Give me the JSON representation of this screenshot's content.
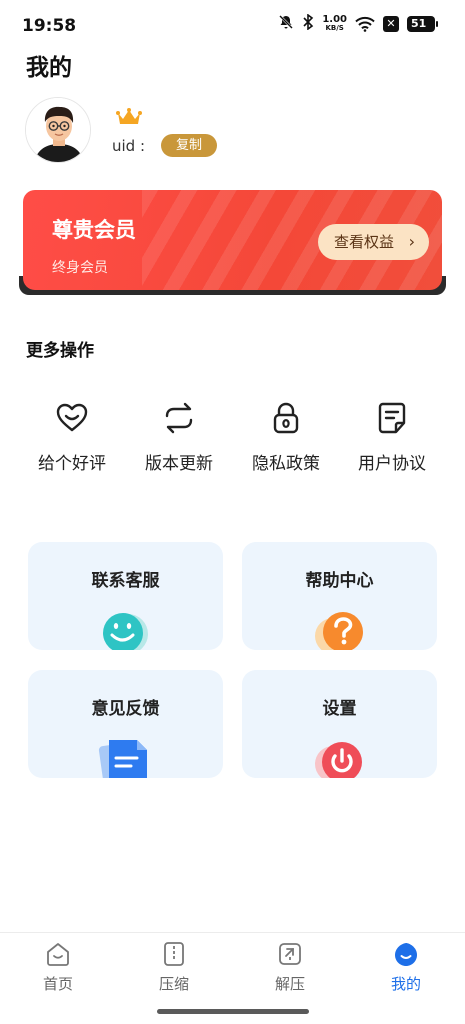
{
  "status_bar": {
    "time": "19:58",
    "net_speed_value": "1.00",
    "net_speed_unit": "KB/S",
    "battery": "51"
  },
  "page": {
    "title": "我的"
  },
  "profile": {
    "uid_label": "uid :",
    "copy_label": "复制"
  },
  "vip": {
    "title": "尊贵会员",
    "subtitle": "终身会员",
    "button_label": "查看权益",
    "button_arrow": "›",
    "colors": {
      "card": "#f44838",
      "button": "#fbe3c4"
    }
  },
  "more_ops": {
    "title": "更多操作",
    "items": [
      {
        "label": "给个好评",
        "icon": "heart-smile-icon"
      },
      {
        "label": "版本更新",
        "icon": "refresh-icon"
      },
      {
        "label": "隐私政策",
        "icon": "lock-icon"
      },
      {
        "label": "用户协议",
        "icon": "document-icon"
      }
    ]
  },
  "cards": [
    {
      "title": "联系客服",
      "icon": "smiley-bubble-icon"
    },
    {
      "title": "帮助中心",
      "icon": "question-icon"
    },
    {
      "title": "意见反馈",
      "icon": "feedback-doc-icon"
    },
    {
      "title": "设置",
      "icon": "power-icon"
    }
  ],
  "bottom_nav": {
    "items": [
      {
        "label": "首页",
        "icon": "home-icon",
        "active": false
      },
      {
        "label": "压缩",
        "icon": "compress-icon",
        "active": false
      },
      {
        "label": "解压",
        "icon": "extract-icon",
        "active": false
      },
      {
        "label": "我的",
        "icon": "profile-drop-icon",
        "active": true
      }
    ],
    "active_color": "#1e6fe8"
  }
}
